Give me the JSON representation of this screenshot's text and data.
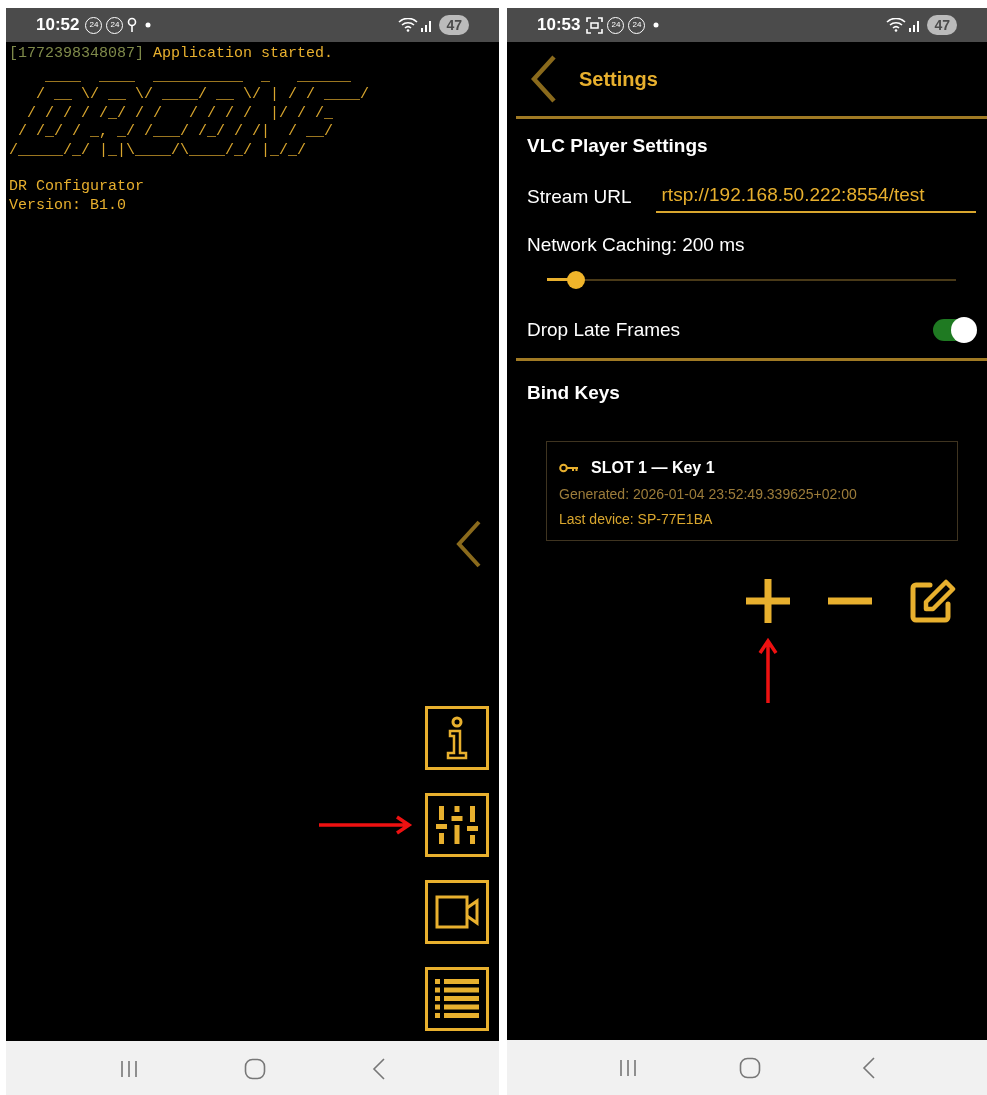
{
  "screens": [
    {
      "status_bar": {
        "time": "10:52",
        "icons": [
          {
            "kind": "badge",
            "text": "24"
          },
          {
            "kind": "badge",
            "text": "24"
          },
          {
            "kind": "location"
          },
          {
            "kind": "dot"
          }
        ],
        "battery": "47"
      },
      "log": [
        {
          "timestamp": "[1772398348087]",
          "message": "Application started."
        }
      ],
      "banner": [
        "    ____  ____  __________  _   ______",
        "   / __ \\/ __ \\/ ____/ __ \\/ | / / ____/",
        "  / / / / /_/ / /   / / / /  |/ / /_",
        " / /_/ / _, _/ /___/ /_/ / /|  / __/",
        "/_____/_/ |_|\\____/\\____/_/ |_/_/"
      ],
      "info": [
        "DR Configurator",
        "Version: B1.0"
      ],
      "side_buttons": [
        {
          "kind": "info",
          "annotated": false
        },
        {
          "kind": "sliders",
          "annotated": true
        },
        {
          "kind": "camera",
          "annotated": false
        },
        {
          "kind": "list",
          "annotated": false
        }
      ]
    },
    {
      "status_bar": {
        "time": "10:53",
        "icons": [
          {
            "kind": "screenshot"
          },
          {
            "kind": "badge",
            "text": "24"
          },
          {
            "kind": "badge",
            "text": "24"
          },
          {
            "kind": "dot"
          }
        ],
        "battery": "47"
      },
      "header": {
        "title": "Settings"
      },
      "vlc": {
        "title": "VLC Player Settings",
        "stream": {
          "label": "Stream URL",
          "value": "rtsp://192.168.50.222:8554/test"
        },
        "caching": {
          "label": "Network Caching: 200 ms",
          "level": 0.07
        },
        "drop_late": {
          "label": "Drop Late Frames",
          "on": true
        }
      },
      "bind_keys": {
        "title": "Bind Keys",
        "keys": [
          {
            "title": "SLOT 1 — Key 1",
            "generated": "Generated: 2026-01-04 23:52:49.339625+02:00",
            "device": "Last device: SP-77E1BA"
          }
        ],
        "actions": [
          {
            "kind": "add",
            "annotated": true
          },
          {
            "kind": "remove",
            "annotated": false
          },
          {
            "kind": "edit",
            "annotated": false
          }
        ]
      }
    }
  ]
}
